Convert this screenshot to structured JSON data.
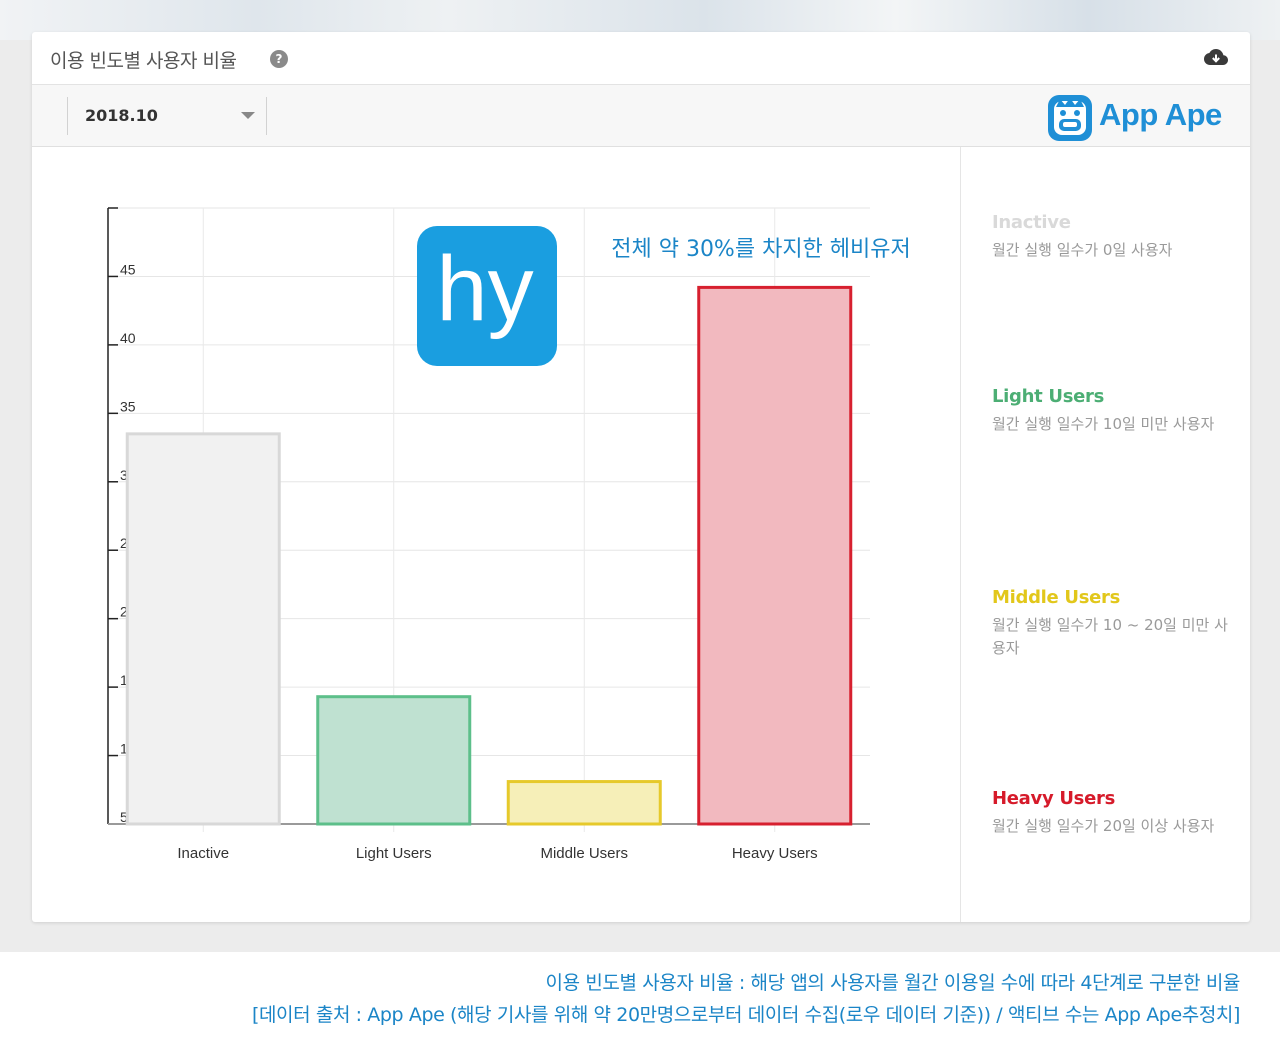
{
  "card": {
    "title": "이용 빈도별 사용자 비율",
    "help_glyph": "?"
  },
  "toolbar": {
    "month_value": "2018.10"
  },
  "brand": {
    "name": "App Ape"
  },
  "app_icon": {
    "text": "hy",
    "bg_color": "#1a9ee0"
  },
  "chart_data": {
    "type": "bar",
    "annotation": "전체 약 30%를 차지한 헤비유저",
    "categories": [
      "Inactive",
      "Light Users",
      "Middle Users",
      "Heavy Users"
    ],
    "values": [
      33.5,
      14.3,
      8.1,
      44.2
    ],
    "yticks": [
      5,
      10,
      15,
      20,
      25,
      30,
      35,
      40,
      45
    ],
    "ylim": [
      5,
      50
    ],
    "grid": true,
    "fill_colors": [
      "#f1f1f1",
      "#bfe1d1",
      "#f6efb8",
      "#f2b9bf"
    ],
    "stroke_colors": [
      "#d8d8d8",
      "#5dbf8a",
      "#e6c92b",
      "#d7202f"
    ]
  },
  "legend": [
    {
      "name": "Inactive",
      "desc": "월간 실행 일수가 0일 사용자",
      "color": "#d9d9d9"
    },
    {
      "name": "Light Users",
      "desc": "월간 실행 일수가 10일 미만 사용자",
      "color": "#4cae74"
    },
    {
      "name": "Middle Users",
      "desc": "월간 실행 일수가 10 ~ 20일 미만 사용자",
      "color": "#e2c71b"
    },
    {
      "name": "Heavy Users",
      "desc": "월간 실행 일수가 20일 이상 사용자",
      "color": "#d61a2a"
    }
  ],
  "caption": {
    "line1": "이용 빈도별 사용자 비율 : 해당 앱의 사용자를 월간 이용일 수에 따라 4단계로 구분한 비율",
    "line2": "[데이터 출처 : App Ape (해당 기사를 위해 약 20만명으로부터 데이터 수집(로우 데이터 기준)) / 액티브 수는 App Ape추정치]"
  }
}
